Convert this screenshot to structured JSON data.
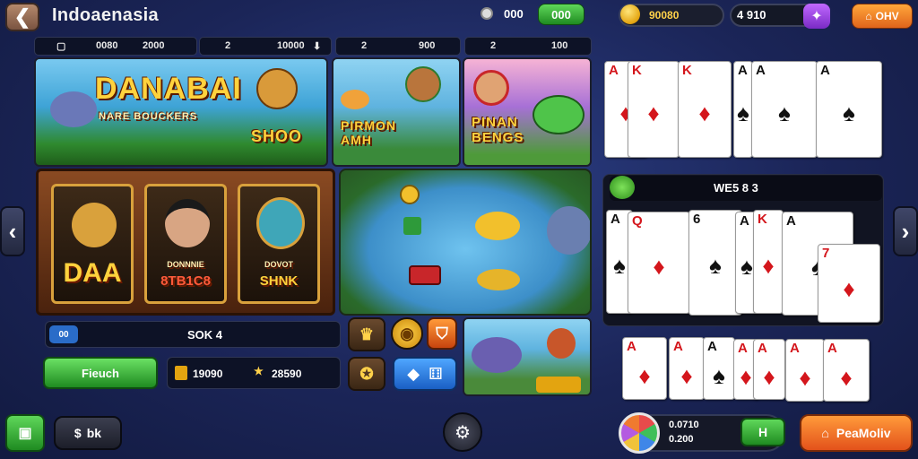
{
  "header": {
    "back_icon": "back-arrow-icon",
    "title": "Indoaenasia",
    "count": "000",
    "green_btn": "000",
    "gold_value": "90080",
    "gem_value": "4 910",
    "orange_btn": "OHV"
  },
  "stats": [
    {
      "a": "0080",
      "b": "2000"
    },
    {
      "a": "2",
      "b": "10000"
    },
    {
      "a": "2",
      "b": "900"
    },
    {
      "a": "2",
      "b": "100"
    }
  ],
  "games": {
    "top_left": {
      "title": "DANABAI",
      "subtitle": "NARE BOUCKERS",
      "badge": "SHOO"
    },
    "top_mid": {
      "title": "PIRMON AMH"
    },
    "top_right": {
      "title": "PINAN BENGS"
    },
    "slot_reels": [
      "DAA",
      "8TB1C8",
      "SHNK"
    ],
    "slot_reels_sub": [
      "",
      "DONNNIE",
      "DOVOT"
    ]
  },
  "info_bar": {
    "icon_label": "00",
    "text": "SOK 4"
  },
  "play_button": "Fieuch",
  "balance_bar": {
    "left": "19090",
    "right": "28590"
  },
  "mid_header": "WE5 8 3",
  "bottom": {
    "left_label": "",
    "chat_label": "bk",
    "profile_line1": "0.0710",
    "profile_line2": "0.200",
    "profile_btn": "H",
    "pay_label": "PeaMoliv"
  },
  "colors": {
    "accent_green": "#1f8b21",
    "accent_orange": "#e3521b",
    "gold": "#ffd24a",
    "bg": "#1b2558"
  }
}
